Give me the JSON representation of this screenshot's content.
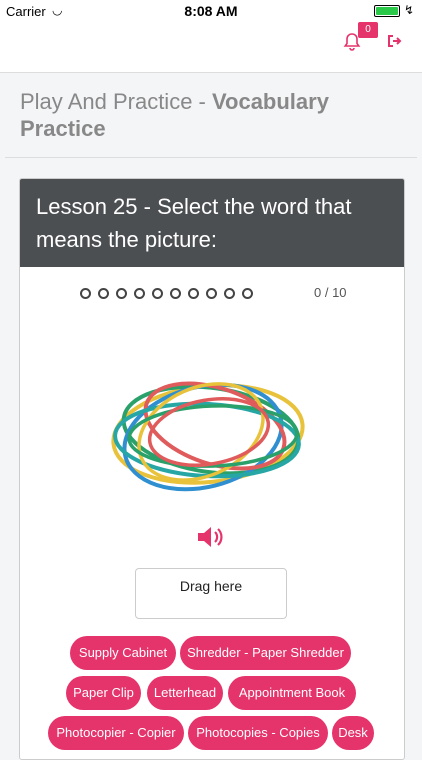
{
  "status_bar": {
    "carrier": "Carrier",
    "time": "8:08 AM"
  },
  "topbar": {
    "notification_count": "0"
  },
  "page": {
    "title_prefix": "Play And Practice - ",
    "title_bold": "Vocabulary Practice"
  },
  "lesson": {
    "header": "Lesson 25 - Select the word that means the picture:",
    "progress": {
      "current": 0,
      "total": 10,
      "label": "0 / 10"
    },
    "image_icon": "rubber-bands-picture",
    "audio_icon": "speaker-icon",
    "dropzone_label": "Drag here"
  },
  "word_options": [
    "Supply Cabinet",
    "Shredder - Paper Shredder",
    "Paper Clip",
    "Letterhead",
    "Appointment Book",
    "Photocopier - Copier",
    "Photocopies - Copies",
    "Desk"
  ],
  "colors": {
    "accent": "#e5336b",
    "header_bg": "#4b4f52"
  }
}
